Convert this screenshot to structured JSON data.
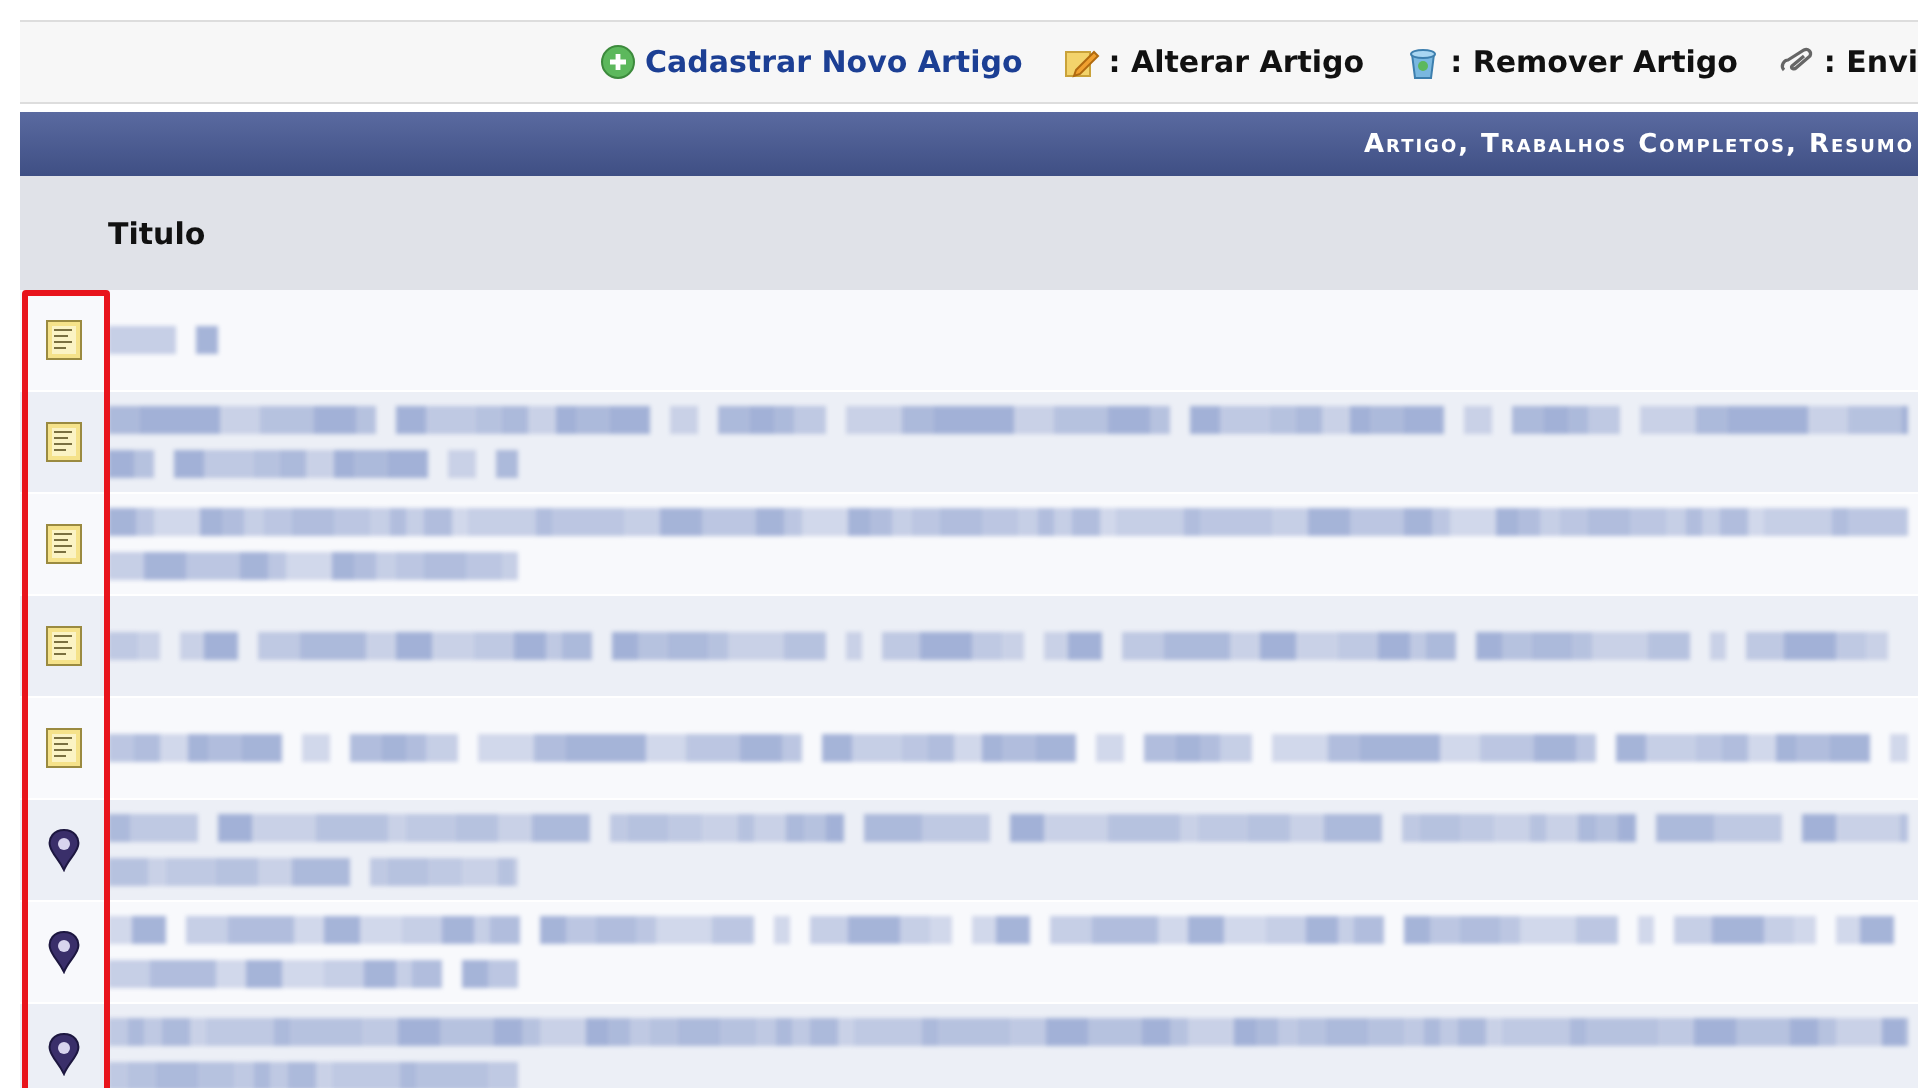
{
  "toolbar": {
    "items": [
      {
        "kind": "add",
        "label": "Cadastrar Novo Artigo"
      },
      {
        "kind": "edit",
        "label": ": Alterar Artigo"
      },
      {
        "kind": "remove",
        "label": ": Remover Artigo"
      },
      {
        "kind": "send",
        "label": ": Envi"
      }
    ]
  },
  "caption": "Artigo, Trabalhos Completos, Resumo",
  "table": {
    "columns": [
      "Titulo"
    ],
    "rows": [
      {
        "kind": "document"
      },
      {
        "kind": "document"
      },
      {
        "kind": "document"
      },
      {
        "kind": "document"
      },
      {
        "kind": "document"
      },
      {
        "kind": "pin"
      },
      {
        "kind": "pin"
      },
      {
        "kind": "pin"
      }
    ]
  },
  "highlight": {
    "on": true
  }
}
